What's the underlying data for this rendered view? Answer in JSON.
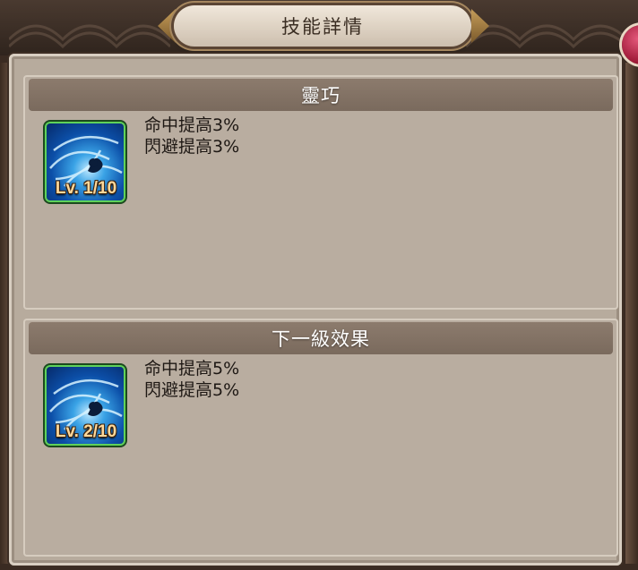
{
  "dialog": {
    "title": "技能詳情"
  },
  "current": {
    "header": "靈巧",
    "level_label": "Lv. 1/10",
    "effects": [
      "命中提高3%",
      "閃避提高3%"
    ]
  },
  "next": {
    "header": "下一級效果",
    "level_label": "Lv. 2/10",
    "effects": [
      "命中提高5%",
      "閃避提高5%"
    ]
  },
  "colors": {
    "panel": "#b7ab9d",
    "header_bar": "#857466",
    "icon_border": "#5fd25a",
    "level_text": "#ffd89a",
    "close_button": "#b8213f"
  },
  "icons": {
    "skill": "blue-wind-skill-icon",
    "close": "close-icon"
  }
}
